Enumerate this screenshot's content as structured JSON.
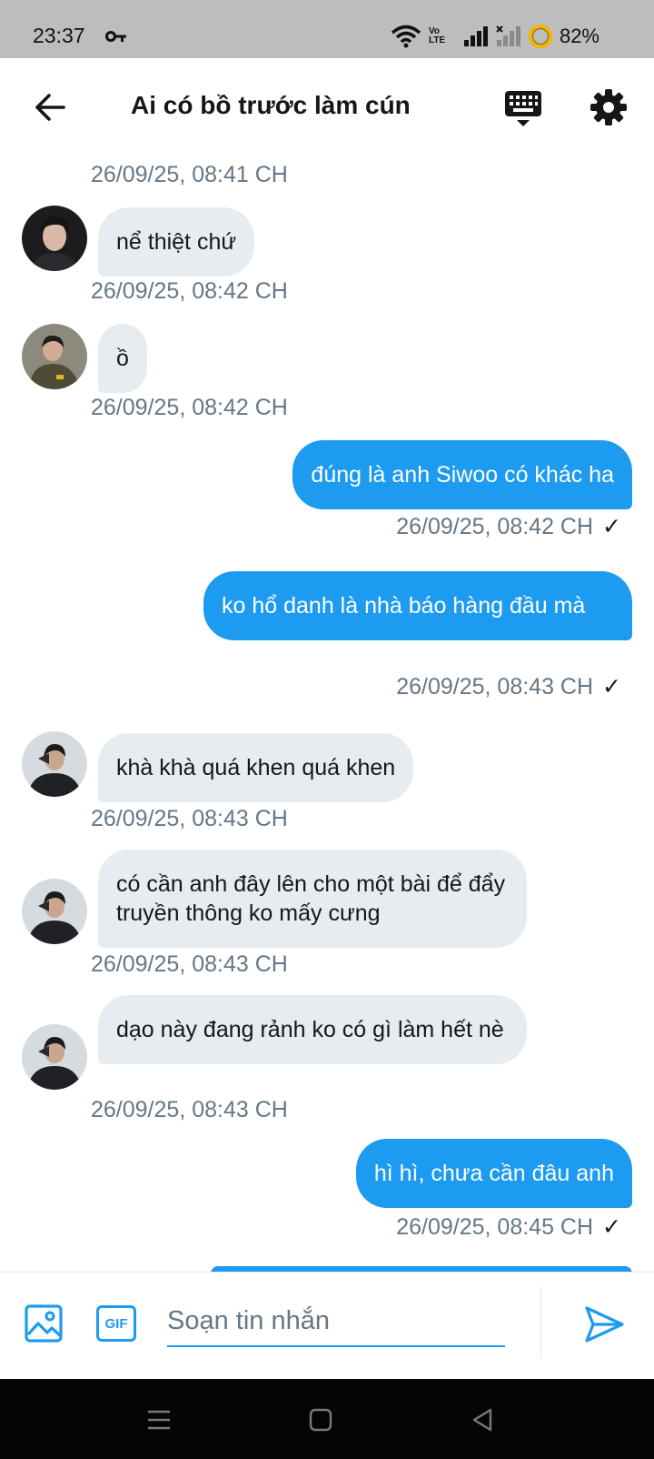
{
  "status_bar": {
    "time": "23:37",
    "network_label": "Vo LTE",
    "battery": "82%"
  },
  "header": {
    "title": "Ai có bồ trước làm cún"
  },
  "messages": [
    {
      "direction": "in",
      "avatar": "avatar-1",
      "text": "nể thiệt chứ",
      "timestamp": "26/09/25, 08:42 CH"
    },
    {
      "direction": "in",
      "avatar": "avatar-2",
      "text": "ồ",
      "timestamp": "26/09/25, 08:42 CH"
    },
    {
      "direction": "out",
      "text": "đúng là anh Siwoo có khác ha",
      "timestamp": "26/09/25, 08:42 CH",
      "read": true
    },
    {
      "direction": "out",
      "text": "ko hổ danh là nhà báo hàng đầu mà",
      "timestamp": "26/09/25, 08:43 CH",
      "read": true
    },
    {
      "direction": "in",
      "avatar": "avatar-3",
      "text": "khà khà quá khen quá khen",
      "timestamp": "26/09/25, 08:43 CH"
    },
    {
      "direction": "in",
      "avatar": "avatar-3",
      "text": "có cần anh đây lên cho một bài để đẩy truyền thông ko mấy cưng",
      "timestamp": "26/09/25, 08:43 CH"
    },
    {
      "direction": "in",
      "avatar": "avatar-3",
      "text": "dạo này đang rảnh ko có gì làm hết nè",
      "timestamp": "26/09/25, 08:43 CH"
    },
    {
      "direction": "out",
      "text": "hì hì, chưa cần đâu anh",
      "timestamp": "26/09/25, 08:45 CH",
      "read": true
    }
  ],
  "top_stamp": "26/09/25, 08:41 CH",
  "check_mark": "✓",
  "composer": {
    "placeholder": "Soạn tin nhắn",
    "gif_label": "GIF"
  },
  "colors": {
    "accent": "#1d9bf0",
    "incoming_bubble": "#e6ecf0",
    "timestamp": "#657786"
  }
}
